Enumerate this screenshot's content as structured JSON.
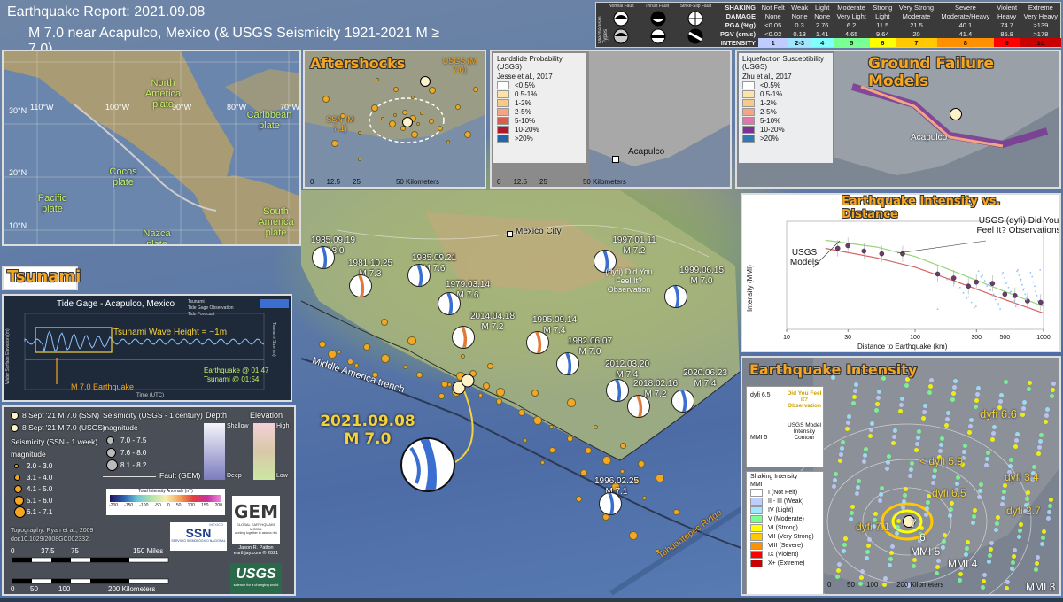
{
  "title": {
    "line1": "Earthquake Report: 2021.09.08",
    "line2": "M 7.0 near Acapulco, Mexico (& USGS Seismicity 1921-2021 M ≥ 7.0)"
  },
  "mechanism_types": {
    "label": "Mechanism Types",
    "items": [
      "Normal Fault",
      "Thrust Fault",
      "Strike-Slip Fault"
    ]
  },
  "mmi_table": {
    "rows": [
      {
        "h": "SHAKING",
        "cells": [
          "Not Felt",
          "Weak",
          "Light",
          "Moderate",
          "Strong",
          "Very Strong",
          "Severe",
          "Violent",
          "Extreme"
        ]
      },
      {
        "h": "DAMAGE",
        "cells": [
          "None",
          "None",
          "None",
          "Very Light",
          "Light",
          "Moderate",
          "Moderate/Heavy",
          "Heavy",
          "Very Heavy"
        ]
      },
      {
        "h": "PGA (%g)",
        "cells": [
          "<0.05",
          "0.3",
          "2.76",
          "6.2",
          "11.5",
          "21.5",
          "40.1",
          "74.7",
          ">139"
        ]
      },
      {
        "h": "PGV (cm/s)",
        "cells": [
          "<0.02",
          "0.13",
          "1.41",
          "4.65",
          "9.64",
          "20",
          "41.4",
          "85.8",
          ">178"
        ]
      }
    ],
    "intensity_label": "INTENSITY",
    "intensity": [
      "1",
      "2-3",
      "4",
      "5",
      "6",
      "7",
      "8",
      "9",
      "10"
    ],
    "colors": [
      "#ffffff",
      "#bfccff",
      "#a0e6ff",
      "#80ffff",
      "#7aff93",
      "#ffff00",
      "#ffc800",
      "#ff9100",
      "#ff0000",
      "#c80000"
    ]
  },
  "tectonic_inset": {
    "lat_labels": [
      "30°N",
      "20°N",
      "10°N",
      "0°"
    ],
    "lon_labels": [
      "110°W",
      "100°W",
      "90°W",
      "80°W",
      "70°W"
    ],
    "plates": [
      "North America plate",
      "Caribbean plate",
      "Cocos plate",
      "Pacific plate",
      "Nazca plate",
      "South America plate"
    ]
  },
  "aftershocks": {
    "title": "Aftershocks",
    "usgs_label": "USGS (M 7.0)",
    "ssn_label": "SSN (M 7.1)",
    "scale": [
      "0",
      "12.5",
      "25",
      "50 Kilometers"
    ]
  },
  "landslide": {
    "title": "Landslide Probability (USGS)",
    "citation": "Jesse et al., 2017",
    "classes": [
      "<0.5%",
      "0.5-1%",
      "1-2%",
      "2-5%",
      "5-10%",
      "10-20%",
      ">20%"
    ],
    "colors": [
      "#ffffff",
      "#fde3a7",
      "#f9c98a",
      "#f4a582",
      "#d6604d",
      "#b2182b",
      "#2166ac"
    ],
    "city": "Acapulco",
    "scale": [
      "0",
      "12.5",
      "25",
      "50 Kilometers"
    ]
  },
  "liquefaction": {
    "title": "Liquefaction Susceptibility (USGS)",
    "citation": "Zhu et al., 2017",
    "classes": [
      "<0.5%",
      "0.5-1%",
      "1-2%",
      "2-5%",
      "5-10%",
      "10-20%",
      ">20%"
    ],
    "colors": [
      "#ffffff",
      "#fde3a7",
      "#f9c98a",
      "#f4a582",
      "#de77ae",
      "#7b3294",
      "#2c7bb6"
    ]
  },
  "ground_failure": {
    "title": "Ground Failure Models",
    "city": "Acapulco"
  },
  "tsunami": {
    "title": "Tsunami",
    "gage_title": "Tide Gage - Acapulco, Mexico",
    "legend": [
      "Tsunami",
      "Tide Gage Observation",
      "Tide Forecast"
    ],
    "wave_label": "Tsunami Wave Height = ~1m",
    "eq_time": "Earthquake @ 01:47",
    "tsunami_time": "Tsunami @ 01:54",
    "eq_marker": "M 7.0 Earthquake",
    "ylabel": "Water Surface Elevation (m)",
    "ylabel2": "Tsunami Size (m)",
    "xlabel": "Time (UTC)"
  },
  "legend": {
    "ssn_main": "8 Sept '21 M 7.0 (SSN)",
    "usgs_main": "8 Sept '21 M 7.0 (USGS)",
    "ssn_week": "Seismicity (SSN - 1 week)",
    "magnitude": "magnitude",
    "ssn_classes": [
      "2.0 - 3.0",
      "3.1 - 4.0",
      "4.1 - 5.0",
      "5.1 - 6.0",
      "6.1 - 7.1"
    ],
    "usgs_century": "Seismicity (USGS - 1 century)",
    "usgs_classes": [
      "7.0 - 7.5",
      "7.6 - 8.0",
      "8.1 - 8.2"
    ],
    "depth": "Depth",
    "shallow": "Shallow",
    "deep": "Deep",
    "elevation": "Elevation",
    "high": "High",
    "low": "Low",
    "fault": "Fault (GEM)",
    "anomaly_title": "Total Intensity Anomaly (nT)",
    "anomaly_ticks": [
      "-200",
      "-150",
      "-100",
      "-50",
      "0",
      "50",
      "100",
      "150",
      "200"
    ],
    "topography": "Topography: Ryan et al., 2009",
    "doi": "doi:10.1029/2008GC002332.",
    "scale_miles": [
      "0",
      "37.5",
      "75",
      "150 Miles"
    ],
    "scale_km": [
      "0",
      "50",
      "100",
      "200 Kilometers"
    ],
    "credit_name": "Jason R. Patton",
    "credit_site": "earthjay.com © 2021",
    "ssn_logo": "SSN",
    "ssn_logo_sub": "MÉXICO",
    "ssn_logo_text": "SERVICIO SISMOLÓGICO NACIONAL",
    "gem_logo": "GEM",
    "gem_logo_sub": "GLOBAL EARTHQUAKE MODEL",
    "gem_logo_tag": "working together to assess risk",
    "usgs_logo": "USGS",
    "usgs_logo_tag": "science for a changing world"
  },
  "main_map": {
    "city": "Mexico City",
    "trench": "Middle America trench",
    "ridge": "Tehuantepec Ridge",
    "main_event_date": "2021.09.08",
    "main_event_mag": "M 7.0",
    "historic": [
      {
        "date": "1985.09.19",
        "mag": "M 8.0"
      },
      {
        "date": "1981.10.25",
        "mag": "M 7.3"
      },
      {
        "date": "1985.09.21",
        "mag": "M 7.6"
      },
      {
        "date": "1979.03.14",
        "mag": "M 7.6"
      },
      {
        "date": "2014.04.18",
        "mag": "M 7.2"
      },
      {
        "date": "1997.01.11",
        "mag": "M 7.2"
      },
      {
        "date": "1999.06.15",
        "mag": "M 7.0"
      },
      {
        "date": "1995.09.14",
        "mag": "M 7.4"
      },
      {
        "date": "1982.06.07",
        "mag": "M 7.0"
      },
      {
        "date": "2012.03.20",
        "mag": "M 7.4"
      },
      {
        "date": "2018.02.16",
        "mag": "M 7.2"
      },
      {
        "date": "2020.06.23",
        "mag": "M 7.4"
      },
      {
        "date": "1996.02.25",
        "mag": "M 7.1"
      }
    ],
    "dyfi_note": "(dyfi) Did You Feel It? Observation"
  },
  "intensity_distance": {
    "title": "Earthquake Intensity vs. Distance",
    "usgs_models": "USGS Models",
    "dyfi_label": "USGS (dyfi) Did You Feel It? Observations",
    "ylabel": "Intensity (MMI)",
    "xlabel": "Distance to Earthquake (km)",
    "x_ticks": [
      "10",
      "30",
      "100",
      "300",
      "500",
      "1000"
    ],
    "chart_data": {
      "type": "scatter",
      "xscale": "log",
      "xlim": [
        10,
        1000
      ],
      "ylim": [
        1,
        9
      ],
      "series": [
        {
          "name": "USGS Models",
          "x": [
            20,
            50,
            100,
            200,
            500,
            1000
          ],
          "y": [
            7.6,
            7.1,
            6.4,
            5.3,
            3.8,
            2.7
          ]
        },
        {
          "name": "USGS Models",
          "x": [
            20,
            50,
            100,
            200,
            500,
            1000
          ],
          "y": [
            7.0,
            6.3,
            5.6,
            4.6,
            3.2,
            2.2
          ]
        },
        {
          "name": "USGS (dyfi) Did You Feel It? Observations",
          "x": [
            25,
            30,
            40,
            55,
            80,
            150,
            200,
            260,
            300,
            400,
            500,
            600,
            750,
            950
          ],
          "y": [
            7.0,
            7.2,
            6.8,
            6.6,
            6.6,
            5.1,
            4.8,
            4.2,
            4.5,
            4.4,
            3.6,
            3.5,
            3.1,
            3.0
          ]
        }
      ]
    }
  },
  "eq_intensity": {
    "title": "Earthquake Intensity",
    "dyfi_sample": "dyfi 6.5",
    "dyfi_sample_label": "Did You Feel It? Observation",
    "mmi_sample": "MMI 5",
    "mmi_sample_label": "USGS Model Intensity Contour",
    "shaking_title": "Shaking Intensity",
    "mmi_label": "MMI",
    "classes": [
      "I (Not Felt)",
      "II - III (Weak)",
      "IV (Light)",
      "V (Moderate)",
      "VI (Strong)",
      "VII (Very Strong)",
      "VIII (Severe)",
      "IX (Violent)",
      "X+ (Extreme)"
    ],
    "colors": [
      "#ffffff",
      "#bfccff",
      "#a0e6ff",
      "#7aff93",
      "#ffff00",
      "#ffc800",
      "#ff9100",
      "#ff0000",
      "#c80000"
    ],
    "labels": [
      "dyfi 6.6",
      "< dyfi 5.9",
      "dyfi 6.5",
      "dyfi 3.4",
      "dyfi 2.7",
      "dyfi 7.1",
      "7",
      "6",
      "MMI 5",
      "MMI 4",
      "MMI 3"
    ],
    "scale": [
      "0",
      "50",
      "100",
      "200 Kilometers"
    ]
  }
}
